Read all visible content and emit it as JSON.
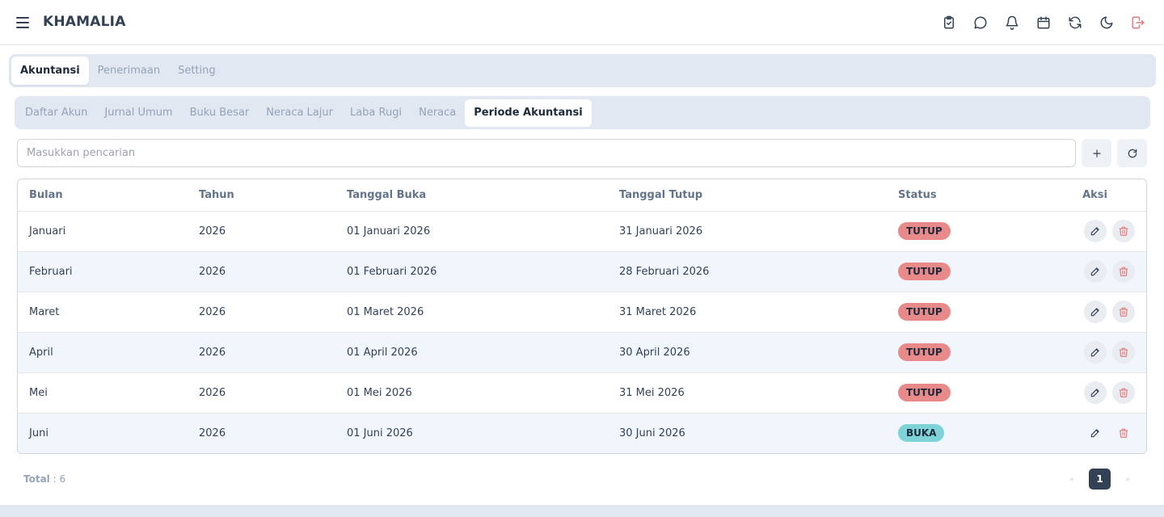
{
  "app": {
    "title": "KHAMALIA"
  },
  "header_icons": [
    "clipboard-check-icon",
    "chat-icon",
    "bell-icon",
    "calendar-icon",
    "refresh-icon",
    "moon-icon",
    "logout-icon"
  ],
  "main_tabs": [
    {
      "label": "Akuntansi",
      "active": true
    },
    {
      "label": "Penerimaan",
      "active": false
    },
    {
      "label": "Setting",
      "active": false
    }
  ],
  "sub_tabs": [
    {
      "label": "Daftar Akun",
      "active": false
    },
    {
      "label": "Jurnal Umum",
      "active": false
    },
    {
      "label": "Buku Besar",
      "active": false
    },
    {
      "label": "Neraca Lajur",
      "active": false
    },
    {
      "label": "Laba Rugi",
      "active": false
    },
    {
      "label": "Neraca",
      "active": false
    },
    {
      "label": "Periode Akuntansi",
      "active": true
    }
  ],
  "search": {
    "placeholder": "Masukkan pencarian",
    "value": ""
  },
  "table": {
    "headers": {
      "bulan": "Bulan",
      "tahun": "Tahun",
      "buka": "Tanggal Buka",
      "tutup": "Tanggal Tutup",
      "status": "Status",
      "aksi": "Aksi"
    },
    "rows": [
      {
        "bulan": "Januari",
        "tahun": "2026",
        "buka": "01 Januari 2026",
        "tutup": "31 Januari 2026",
        "status": "TUTUP"
      },
      {
        "bulan": "Februari",
        "tahun": "2026",
        "buka": "01 Februari 2026",
        "tutup": "28 Februari 2026",
        "status": "TUTUP"
      },
      {
        "bulan": "Maret",
        "tahun": "2026",
        "buka": "01 Maret 2026",
        "tutup": "31 Maret 2026",
        "status": "TUTUP"
      },
      {
        "bulan": "April",
        "tahun": "2026",
        "buka": "01 April 2026",
        "tutup": "30 April 2026",
        "status": "TUTUP"
      },
      {
        "bulan": "Mei",
        "tahun": "2026",
        "buka": "01 Mei 2026",
        "tutup": "31 Mei 2026",
        "status": "TUTUP"
      },
      {
        "bulan": "Juni",
        "tahun": "2026",
        "buka": "01 Juni 2026",
        "tutup": "30 Juni 2026",
        "status": "BUKA"
      }
    ]
  },
  "footer": {
    "total_label": "Total",
    "total_value": ": 6",
    "current_page": "1",
    "prev": "«",
    "next": "»"
  },
  "colors": {
    "tutup": "#e88a8a",
    "buka": "#7dd3d8",
    "accent": "#334155",
    "delete": "#e27b7b"
  }
}
